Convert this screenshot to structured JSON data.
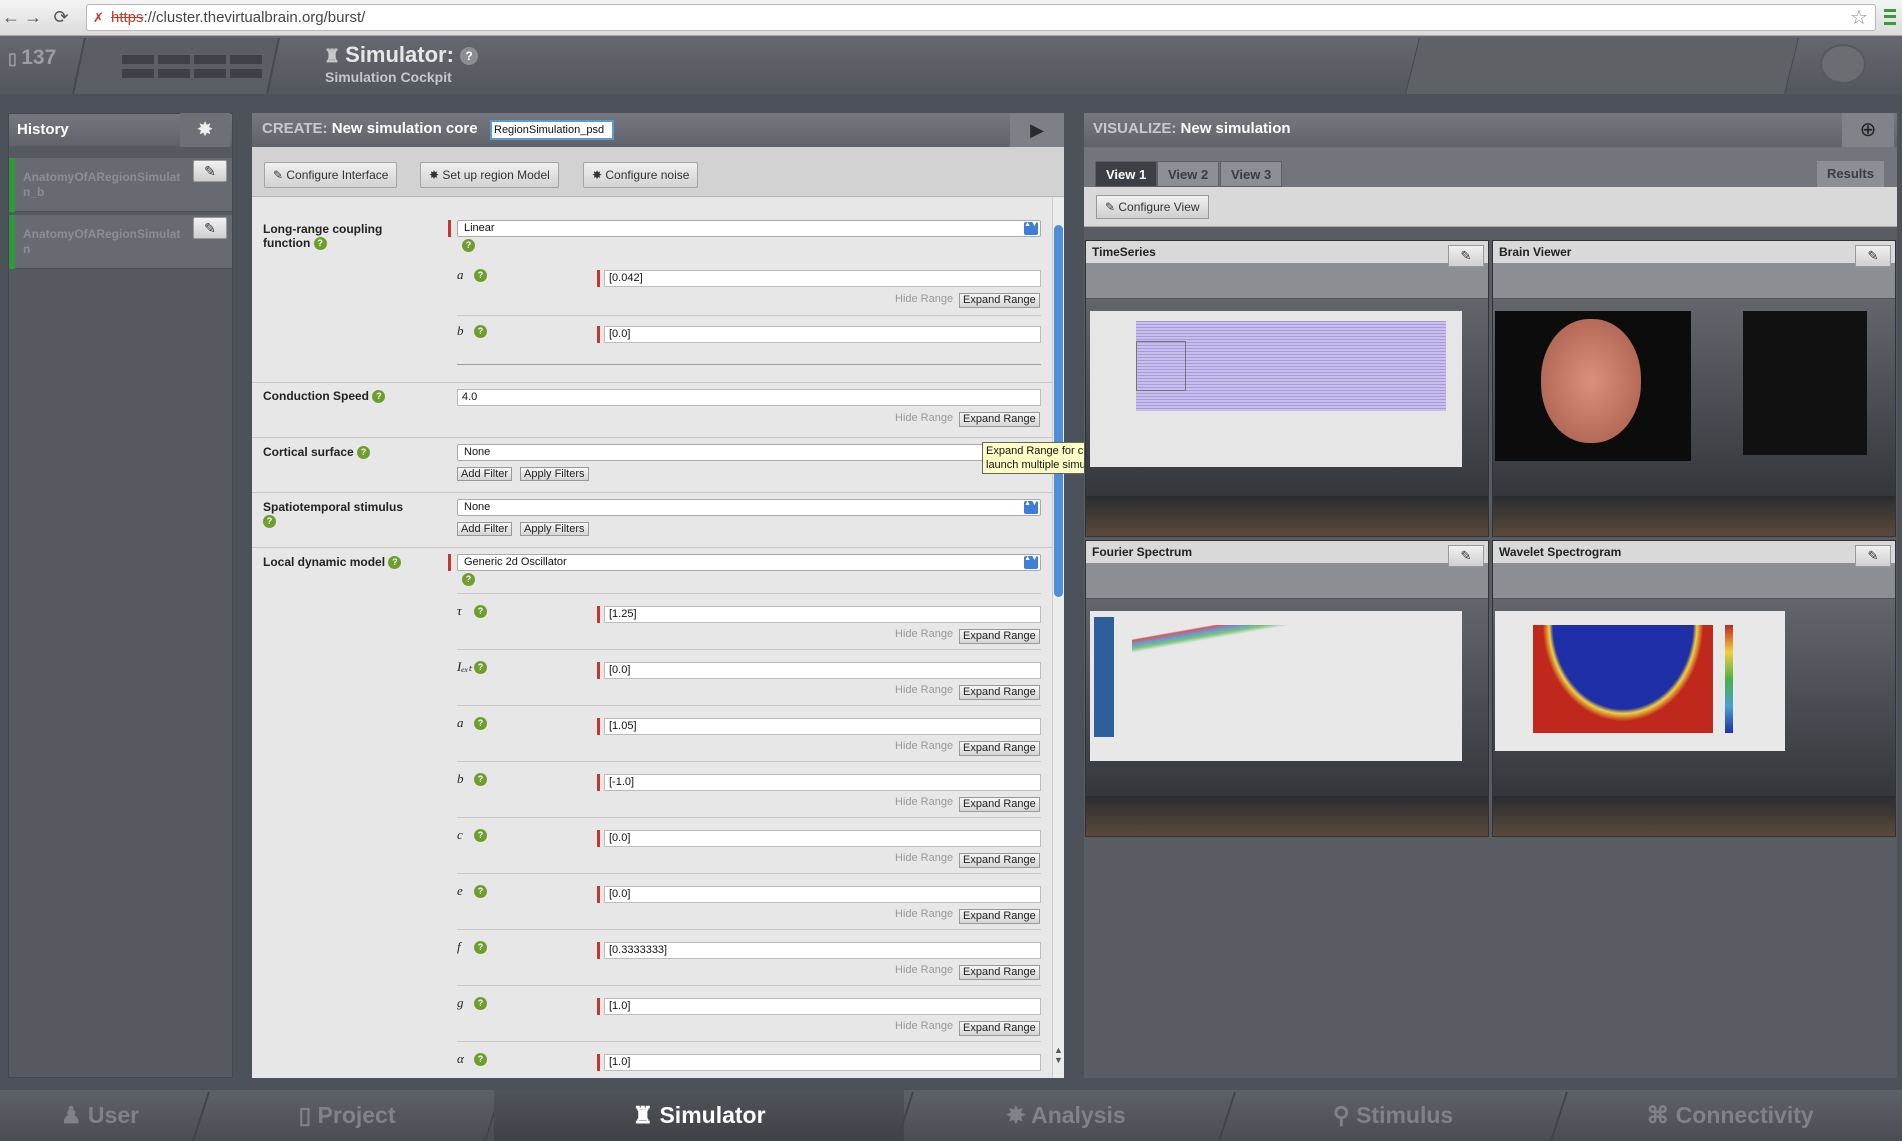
{
  "browser": {
    "url_scheme": "https",
    "url_rest": "://cluster.thevirtualbrain.org/burst/"
  },
  "header": {
    "counter": "137",
    "title": "Simulator:",
    "help": "?",
    "subtitle": "Simulation Cockpit"
  },
  "history": {
    "title": "History",
    "items": [
      {
        "line1": "AnatomyOfARegionSimulat",
        "line2": "n_b"
      },
      {
        "line1": "AnatomyOfARegionSimulat",
        "line2": "n"
      }
    ]
  },
  "create": {
    "prefix": "CREATE:",
    "title": "New simulation core",
    "sim_name": "RegionSimulation_psd",
    "toolbar": {
      "configure_interface": "Configure Interface",
      "setup_region": "Set up region Model",
      "configure_noise": "Configure noise"
    },
    "coupling": {
      "label_line1": "Long-range coupling",
      "label_line2": "function",
      "value": "Linear",
      "params": [
        {
          "sym": "a",
          "value": "[0.042]"
        },
        {
          "sym": "b",
          "value": "[0.0]"
        }
      ]
    },
    "conduction": {
      "label": "Conduction Speed",
      "value": "4.0"
    },
    "cortical": {
      "label": "Cortical surface",
      "value": "None"
    },
    "stimulus": {
      "label": "Spatiotemporal stimulus",
      "value": "None"
    },
    "dynamic": {
      "label": "Local dynamic model",
      "value": "Generic 2d Oscillator",
      "params": [
        {
          "sym": "τ",
          "value": "[1.25]"
        },
        {
          "sym": "Iₑₓₜ",
          "value": "[0.0]"
        },
        {
          "sym": "a",
          "value": "[1.05]"
        },
        {
          "sym": "b",
          "value": "[-1.0]"
        },
        {
          "sym": "c",
          "value": "[0.0]"
        },
        {
          "sym": "e",
          "value": "[0.0]"
        },
        {
          "sym": "f",
          "value": "[0.3333333]"
        },
        {
          "sym": "g",
          "value": "[1.0]"
        },
        {
          "sym": "α",
          "value": "[1.0]"
        }
      ]
    },
    "hide_range": "Hide Range",
    "expand_range": "Expand Range",
    "add_filter": "Add Filter",
    "apply_filters": "Apply Filters",
    "tooltip": "Expand Range for current parameter. This will launch multiple simulations!"
  },
  "visualize": {
    "prefix": "VISUALIZE:",
    "title": "New simulation",
    "tabs": [
      "View 1",
      "View 2",
      "View 3"
    ],
    "results": "Results",
    "configure_view": "Configure View",
    "cells": [
      "TimeSeries",
      "Brain Viewer",
      "Fourier Spectrum",
      "Wavelet Spectrogram"
    ]
  },
  "bottom_nav": [
    "User",
    "Project",
    "Simulator",
    "Analysis",
    "Stimulus",
    "Connectivity"
  ]
}
